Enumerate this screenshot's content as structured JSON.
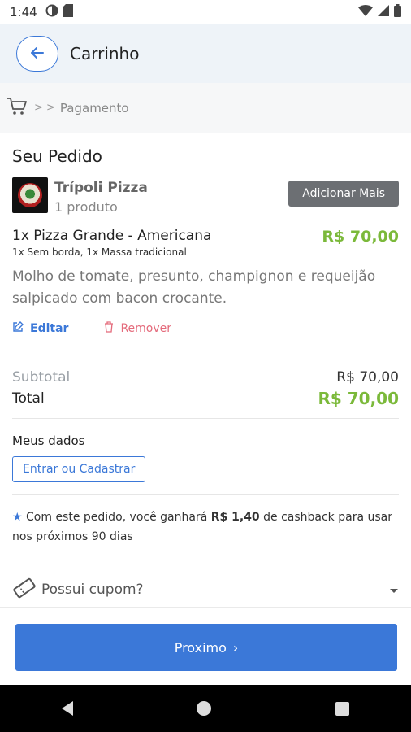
{
  "status": {
    "time": "1:44"
  },
  "header": {
    "title": "Carrinho"
  },
  "breadcrumb": {
    "separators": "> >",
    "current": "Pagamento"
  },
  "order": {
    "section_title": "Seu Pedido",
    "store_name": "Trípoli Pizza",
    "store_qty": "1 produto",
    "add_more_label": "Adicionar Mais",
    "item": {
      "name": "1x Pizza Grande - Americana",
      "price": "R$ 70,00",
      "options": "1x Sem borda, 1x Massa tradicional",
      "description": "Molho de tomate, presunto, champignon e requeijão salpicado com bacon crocante."
    },
    "edit_label": "Editar",
    "remove_label": "Remover"
  },
  "totals": {
    "subtotal_label": "Subtotal",
    "subtotal_value": "R$ 70,00",
    "total_label": "Total",
    "total_value": "R$ 70,00"
  },
  "my_data": {
    "title": "Meus dados",
    "login_label": "Entrar ou Cadastrar"
  },
  "cashback": {
    "star": "★",
    "prefix": "Com este pedido, você ganhará",
    "amount": "R$ 1,40",
    "suffix": "de cashback para usar nos próximos 90 dias"
  },
  "coupon": {
    "label": "Possui cupom?"
  },
  "footer": {
    "next_label": "Proximo",
    "next_arrow": "›"
  },
  "colors": {
    "accent": "#3b78d8",
    "price": "#7bb93a",
    "remove": "#e46a7b"
  }
}
